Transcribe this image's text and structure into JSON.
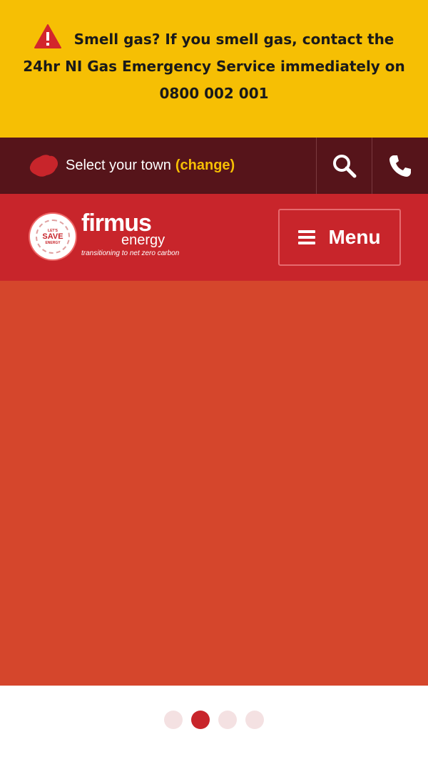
{
  "alert": {
    "text": "Smell gas? If you smell gas, contact the 24hr NI Gas Emergency Service immediately on 0800 002 001",
    "icon": "warning-icon",
    "bg_color": "#f6bf04"
  },
  "townbar": {
    "label": "Select your town",
    "change": "(change)",
    "icons": [
      "northern-ireland-map-icon",
      "search-icon",
      "phone-icon"
    ],
    "bg_color": "#56141a"
  },
  "header": {
    "logo": {
      "badge_top": "LET'S",
      "badge_main": "SAVE",
      "badge_bottom": "ENERGY",
      "brand": "firmus",
      "brand_sub": "energy",
      "tagline": "transitioning to net zero carbon"
    },
    "menu_label": "Menu",
    "bg_color": "#c8252b"
  },
  "hero": {
    "bg_color": "#d5462c"
  },
  "carousel": {
    "slide_count": 4,
    "active_index": 1
  }
}
